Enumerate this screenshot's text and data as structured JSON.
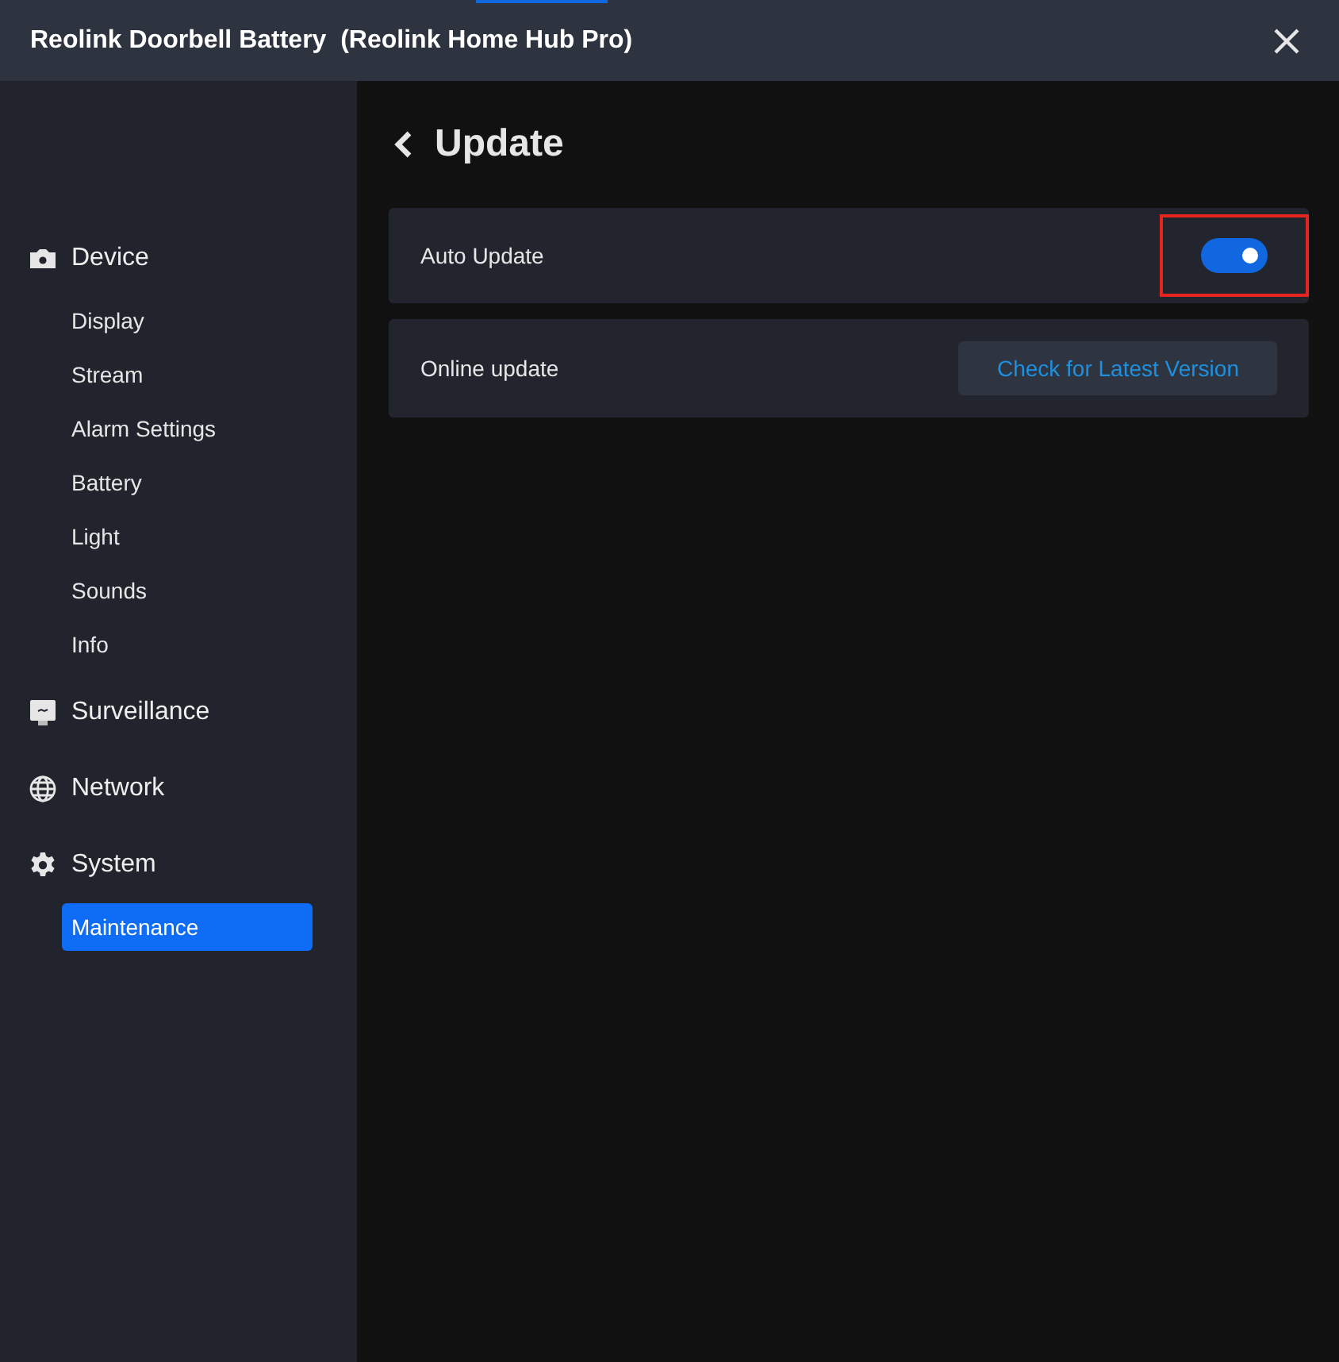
{
  "window": {
    "title": "Reolink Doorbell Battery  (Reolink Home Hub Pro)"
  },
  "sidebar": {
    "groups": [
      {
        "label": "Device",
        "children": [
          {
            "label": "Display",
            "selected": false
          },
          {
            "label": "Stream",
            "selected": false
          },
          {
            "label": "Alarm Settings",
            "selected": false
          },
          {
            "label": "Battery",
            "selected": false
          },
          {
            "label": "Light",
            "selected": false
          },
          {
            "label": "Sounds",
            "selected": false
          },
          {
            "label": "Info",
            "selected": false
          }
        ]
      },
      {
        "label": "Surveillance"
      },
      {
        "label": "Network"
      },
      {
        "label": "System",
        "children": [
          {
            "label": "Maintenance",
            "selected": true
          }
        ]
      }
    ]
  },
  "page": {
    "title": "Update"
  },
  "settings": [
    {
      "kind": "toggle",
      "label": "Auto Update",
      "on": true,
      "highlighted": true
    },
    {
      "kind": "button",
      "label": "Online update",
      "button": "Check for Latest Version"
    }
  ]
}
